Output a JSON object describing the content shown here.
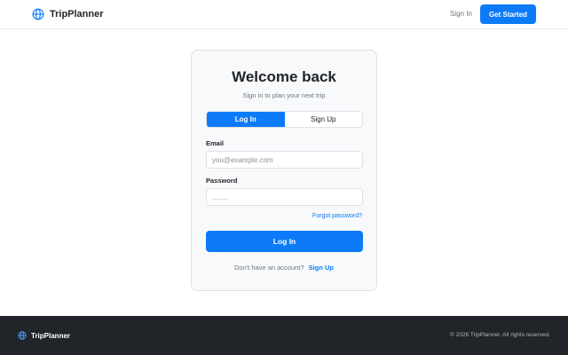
{
  "header": {
    "brand": "TripPlanner",
    "brand_icon": "globe-icon",
    "sign_in": "Sign In",
    "get_started": "Get Started"
  },
  "card": {
    "title": "Welcome back",
    "subtitle": "Sign in to plan your next trip",
    "tabs": [
      {
        "label": "Log In",
        "active": true
      },
      {
        "label": "Sign Up",
        "active": false
      }
    ],
    "email_label": "Email",
    "email_placeholder": "you@example.com",
    "email_value": "",
    "password_label": "Password",
    "password_placeholder": "........",
    "password_value": "",
    "forgot": "Forgot password?",
    "submit": "Log In",
    "no_account": "Don't have an account?",
    "signup_link": "Sign Up"
  },
  "footer": {
    "brand": "TripPlanner",
    "copyright": "© 2026 TripPlanner. All rights reserved."
  },
  "colors": {
    "accent": "#0d7bf7",
    "footer_bg": "#212529",
    "card_bg": "#f8f9fa"
  }
}
